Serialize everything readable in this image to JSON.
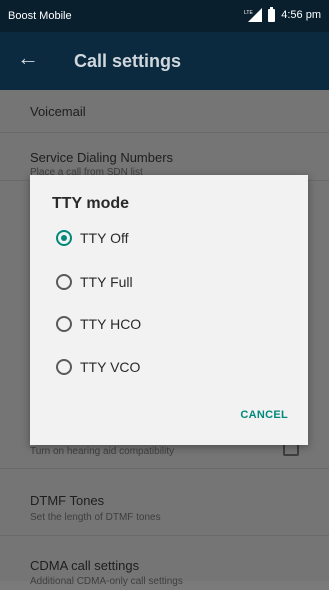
{
  "status_bar": {
    "carrier": "Boost Mobile",
    "time": "4:56 pm"
  },
  "app_bar": {
    "title": "Call settings"
  },
  "settings": [
    {
      "title": "Voicemail",
      "subtitle": ""
    },
    {
      "title": "Service Dialing Numbers",
      "subtitle": "Place a call from SDN list"
    },
    {
      "title": "",
      "subtitle": "Turn on hearing aid compatibility"
    },
    {
      "title": "DTMF Tones",
      "subtitle": "Set the length of DTMF tones"
    },
    {
      "title": "CDMA call settings",
      "subtitle": "Additional CDMA-only call settings"
    }
  ],
  "dialog": {
    "title": "TTY mode",
    "options": [
      {
        "label": "TTY Off",
        "selected": true
      },
      {
        "label": "TTY Full",
        "selected": false
      },
      {
        "label": "TTY HCO",
        "selected": false
      },
      {
        "label": "TTY VCO",
        "selected": false
      }
    ],
    "cancel_label": "CANCEL"
  },
  "colors": {
    "accent": "#00897b",
    "appbar": "#0b2a3f",
    "statusbar": "#0a1f2e"
  }
}
